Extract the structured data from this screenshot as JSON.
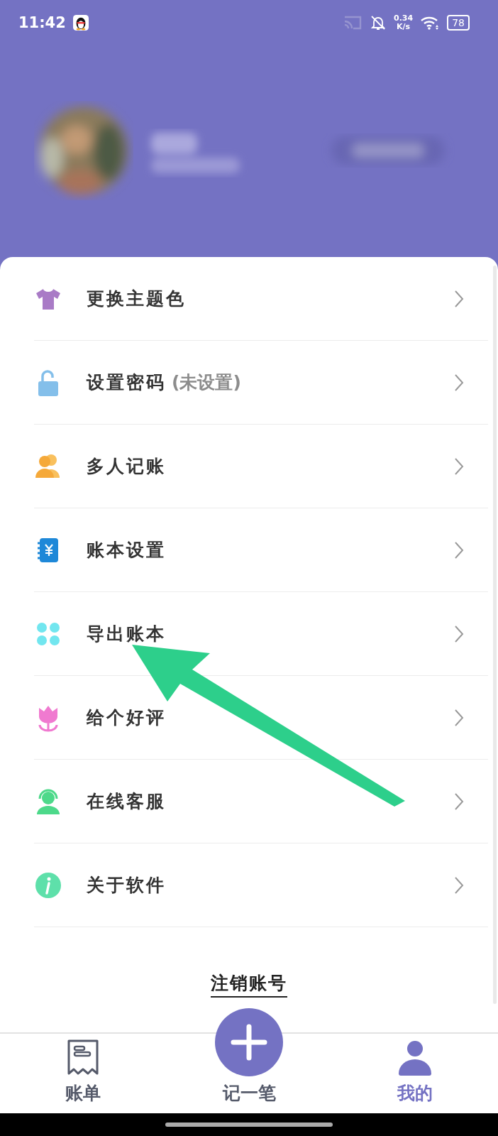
{
  "status_bar": {
    "time": "11:42",
    "speed_value": "0.34",
    "speed_unit": "K/s",
    "battery": "78"
  },
  "menu": [
    {
      "kind": "shirt",
      "label": "更换主题色"
    },
    {
      "kind": "lock",
      "label": "设置密码",
      "note": "(未设置)"
    },
    {
      "kind": "people",
      "label": "多人记账"
    },
    {
      "kind": "ledger",
      "label": "账本设置"
    },
    {
      "kind": "clover",
      "label": "导出账本"
    },
    {
      "kind": "tulip",
      "label": "给个好评"
    },
    {
      "kind": "agent",
      "label": "在线客服"
    },
    {
      "kind": "info",
      "label": "关于软件"
    }
  ],
  "logout": {
    "label": "注销账号"
  },
  "tab_bar": [
    {
      "kind": "receipt",
      "label": "账单",
      "selected": false
    },
    {
      "kind": "plus",
      "label": "记一笔",
      "selected": false
    },
    {
      "kind": "person",
      "label": "我的",
      "selected": true
    }
  ]
}
